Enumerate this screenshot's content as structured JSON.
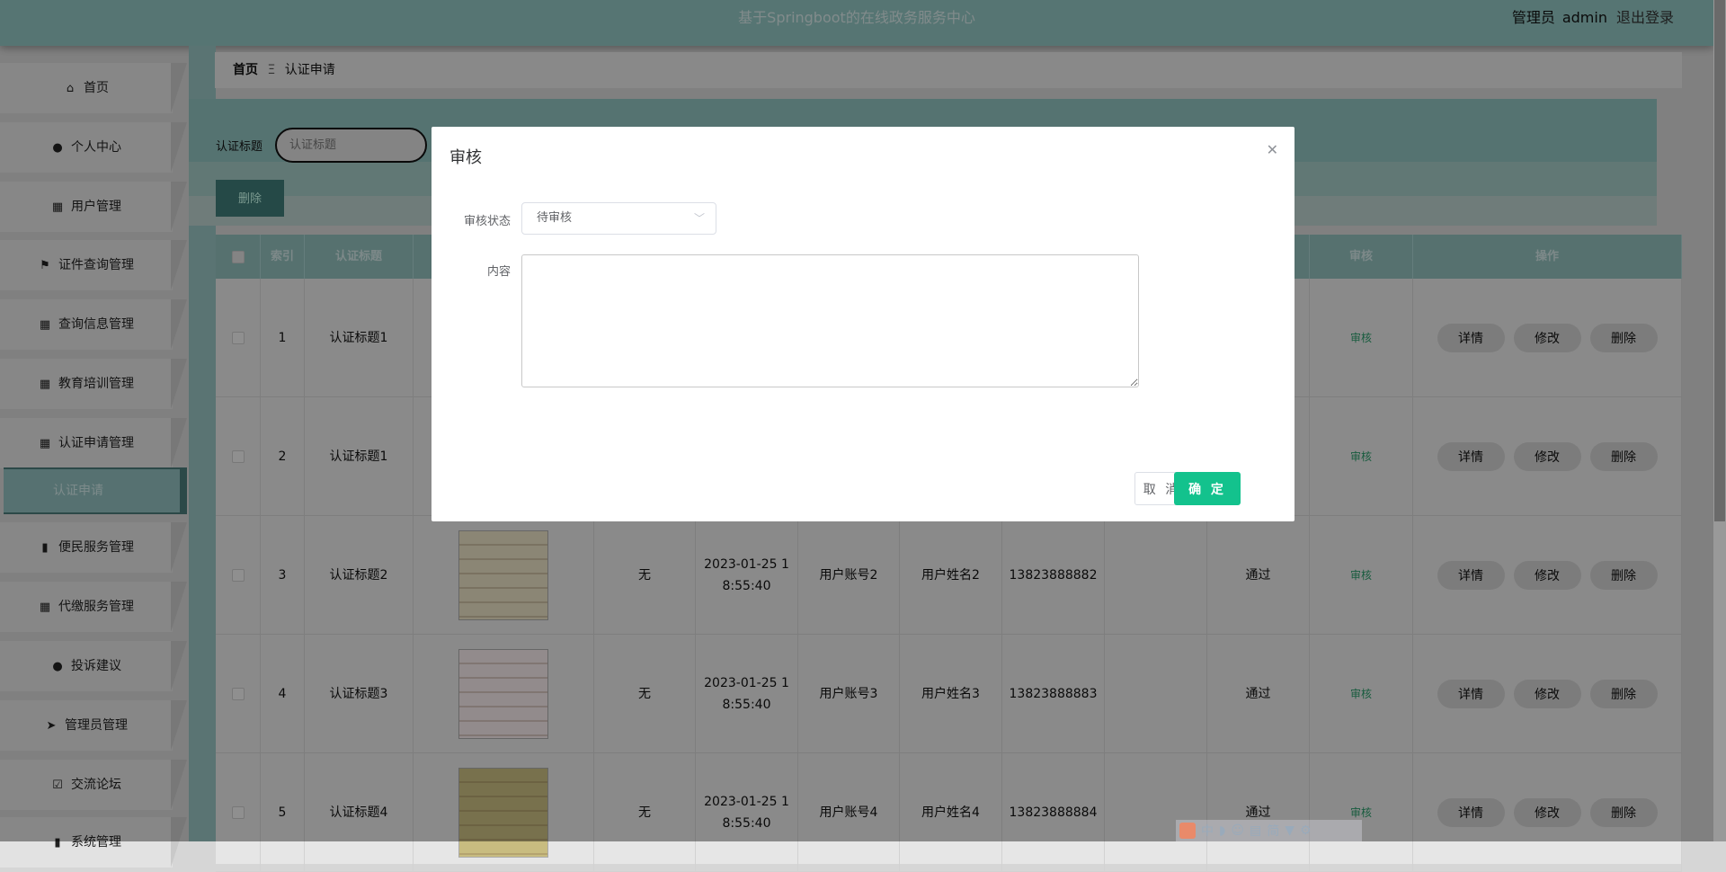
{
  "header": {
    "title": "基于Springboot的在线政务服务中心",
    "user_role": "管理员",
    "username": "admin",
    "logout": "退出登录"
  },
  "sidebar": {
    "items": [
      {
        "label": "首页",
        "icon": "home-icon",
        "glyph": "⌂"
      },
      {
        "label": "个人中心",
        "icon": "user-icon",
        "glyph": "●"
      },
      {
        "label": "用户管理",
        "icon": "grid-icon",
        "glyph": "▦"
      },
      {
        "label": "证件查询管理",
        "icon": "flag-icon",
        "glyph": "⚑"
      },
      {
        "label": "查询信息管理",
        "icon": "grid-icon",
        "glyph": "▦"
      },
      {
        "label": "教育培训管理",
        "icon": "grid-icon",
        "glyph": "▦"
      },
      {
        "label": "认证申请管理",
        "icon": "grid-icon",
        "glyph": "▦"
      },
      {
        "label": "便民服务管理",
        "icon": "bar-chart-icon",
        "glyph": "▮"
      },
      {
        "label": "代缴服务管理",
        "icon": "grid-icon",
        "glyph": "▦"
      },
      {
        "label": "投诉建议",
        "icon": "user-icon",
        "glyph": "●"
      },
      {
        "label": "管理员管理",
        "icon": "send-icon",
        "glyph": "➤"
      },
      {
        "label": "交流论坛",
        "icon": "clipboard-check-icon",
        "glyph": "☑"
      },
      {
        "label": "系统管理",
        "icon": "gear-icon",
        "glyph": "▮"
      }
    ],
    "active_sub": "认证申请"
  },
  "breadcrumb": {
    "home": "首页",
    "separator": "Ξ",
    "current": "认证申请"
  },
  "search": {
    "label": "认证标题",
    "placeholder": "认证标题",
    "delete_label": "删除"
  },
  "table": {
    "headers": {
      "index": "索引",
      "title": "认证标题",
      "review": "审核",
      "actions": "操作"
    },
    "rows": [
      {
        "index": "1",
        "title": "认证标题1",
        "remark": "",
        "time": "",
        "account": "",
        "name": "",
        "phone": "",
        "status": "",
        "review": "审核",
        "cert": "none"
      },
      {
        "index": "2",
        "title": "认证标题1",
        "remark": "",
        "time": "",
        "account": "",
        "name": "",
        "phone": "",
        "status": "",
        "review": "审核",
        "cert": "none"
      },
      {
        "index": "3",
        "title": "认证标题2",
        "remark": "无",
        "time": "2023-01-25 18:55:40",
        "account": "用户账号2",
        "name": "用户姓名2",
        "phone": "13823888882",
        "status": "通过",
        "review": "审核",
        "cert": "#e8dfc4"
      },
      {
        "index": "4",
        "title": "认证标题3",
        "remark": "无",
        "time": "2023-01-25 18:55:40",
        "account": "用户账号3",
        "name": "用户姓名3",
        "phone": "13823888883",
        "status": "通过",
        "review": "审核",
        "cert": "#f4e8ea"
      },
      {
        "index": "5",
        "title": "认证标题4",
        "remark": "无",
        "time": "2023-01-25 18:55:40",
        "account": "用户账号4",
        "name": "用户姓名4",
        "phone": "13823888884",
        "status": "通过",
        "review": "审核",
        "cert": "#c8bc80"
      }
    ],
    "row_actions": {
      "detail": "详情",
      "edit": "修改",
      "delete": "删除"
    }
  },
  "modal": {
    "title": "审核",
    "status_label": "审核状态",
    "status_value": "待审核",
    "content_label": "内容",
    "content_value": "",
    "cancel": "取 消",
    "confirm": "确 定"
  },
  "ime": {
    "mode": "中",
    "simplified": "简"
  },
  "colors": {
    "accent": "#13c28d",
    "header": "#8fc3c0",
    "review_link": "#2a9a6a"
  }
}
